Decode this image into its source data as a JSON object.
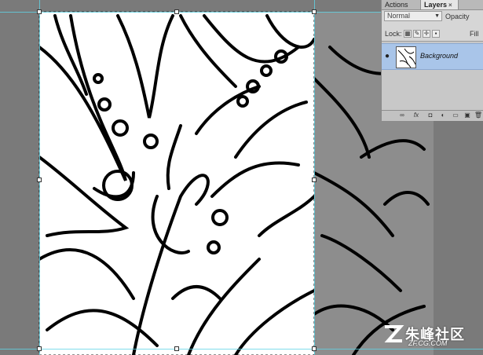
{
  "layers_panel": {
    "tabs": [
      {
        "label": "Actions"
      },
      {
        "label": "Layers",
        "close": "×"
      }
    ],
    "blend_mode": "Normal",
    "opacity_label": "Opacity",
    "lock_label": "Lock:",
    "fill_label": "Fill",
    "layers": [
      {
        "name": "Background"
      }
    ],
    "bottom_buttons": [
      "link-icon",
      "fx-icon",
      "mask-icon",
      "adjustment-icon",
      "folder-icon",
      "new-layer-icon",
      "trash-icon"
    ]
  },
  "watermark": {
    "text": "朱峰社区",
    "sub": "ZF.CG.COM"
  },
  "colors": {
    "selection_guide": "#5fd4e6",
    "layer_selected": "#a9c5e9"
  }
}
